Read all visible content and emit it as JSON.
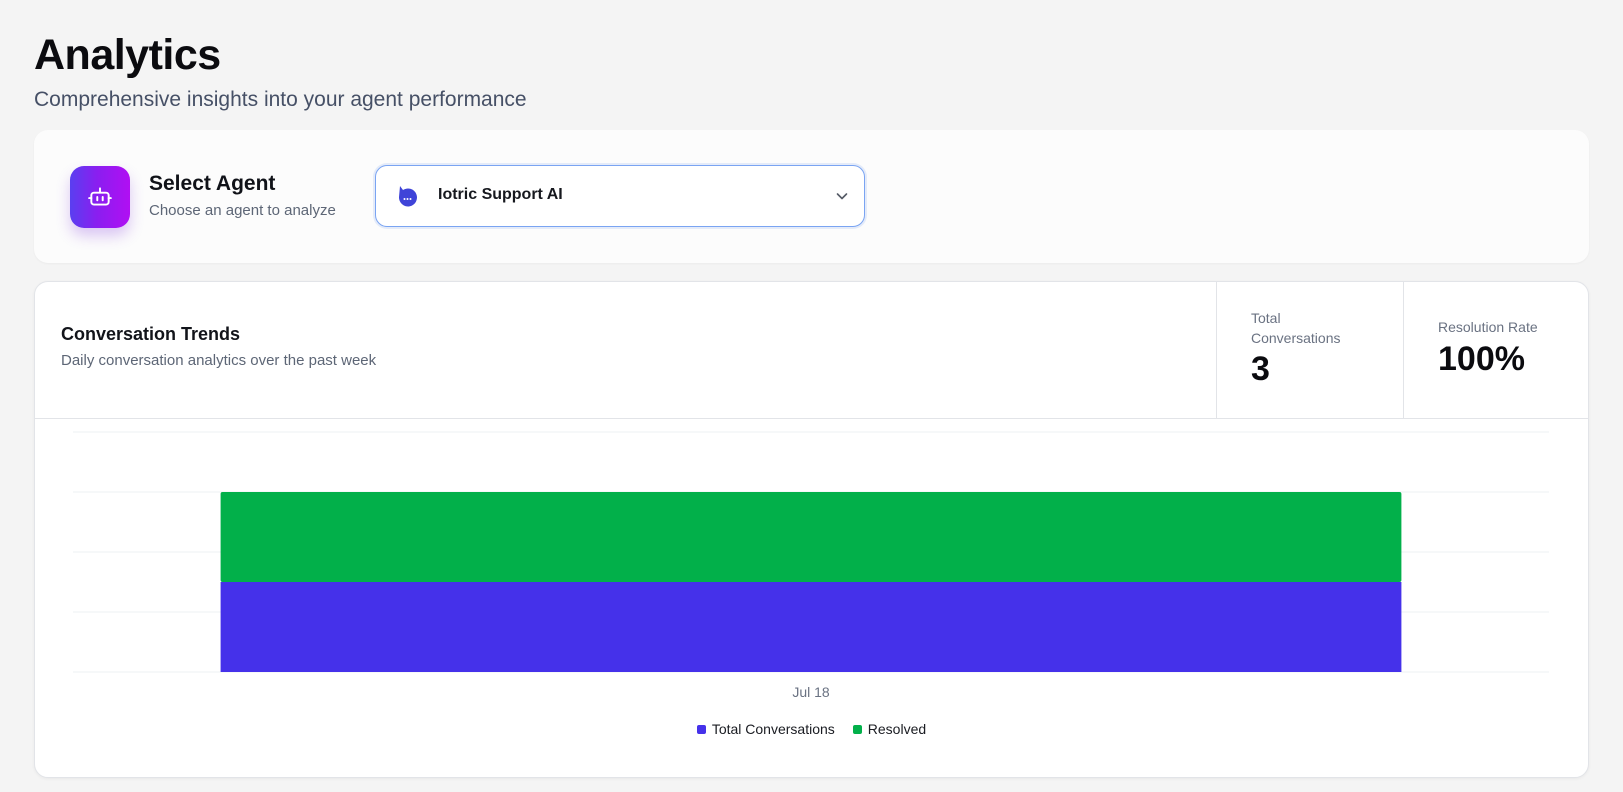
{
  "page": {
    "title": "Analytics",
    "subtitle": "Comprehensive insights into your agent performance"
  },
  "agent_selector": {
    "heading": "Select Agent",
    "subheading": "Choose an agent to analyze",
    "selected_agent": "Iotric Support AI",
    "icon": "robot-icon"
  },
  "trends": {
    "title": "Conversation Trends",
    "subtitle": "Daily conversation analytics over the past week",
    "stats": {
      "total_label": "Total Conversations",
      "total_value": "3",
      "rate_label": "Resolution Rate",
      "rate_value": "100%"
    }
  },
  "colors": {
    "total": "#4531ea",
    "resolved": "#02b04a",
    "accent_gradient_start": "#5a3ff0",
    "accent_gradient_end": "#b10ff3"
  },
  "chart_data": {
    "type": "bar",
    "stacked": true,
    "categories": [
      "Jul 18"
    ],
    "series": [
      {
        "name": "Total Conversations",
        "values": [
          3
        ],
        "color": "#4531ea"
      },
      {
        "name": "Resolved",
        "values": [
          3
        ],
        "color": "#02b04a"
      }
    ],
    "ylim": [
      0,
      8
    ],
    "y_gridlines": [
      0,
      2,
      4,
      6,
      8
    ],
    "grid": true,
    "legend": "bottom-center"
  }
}
